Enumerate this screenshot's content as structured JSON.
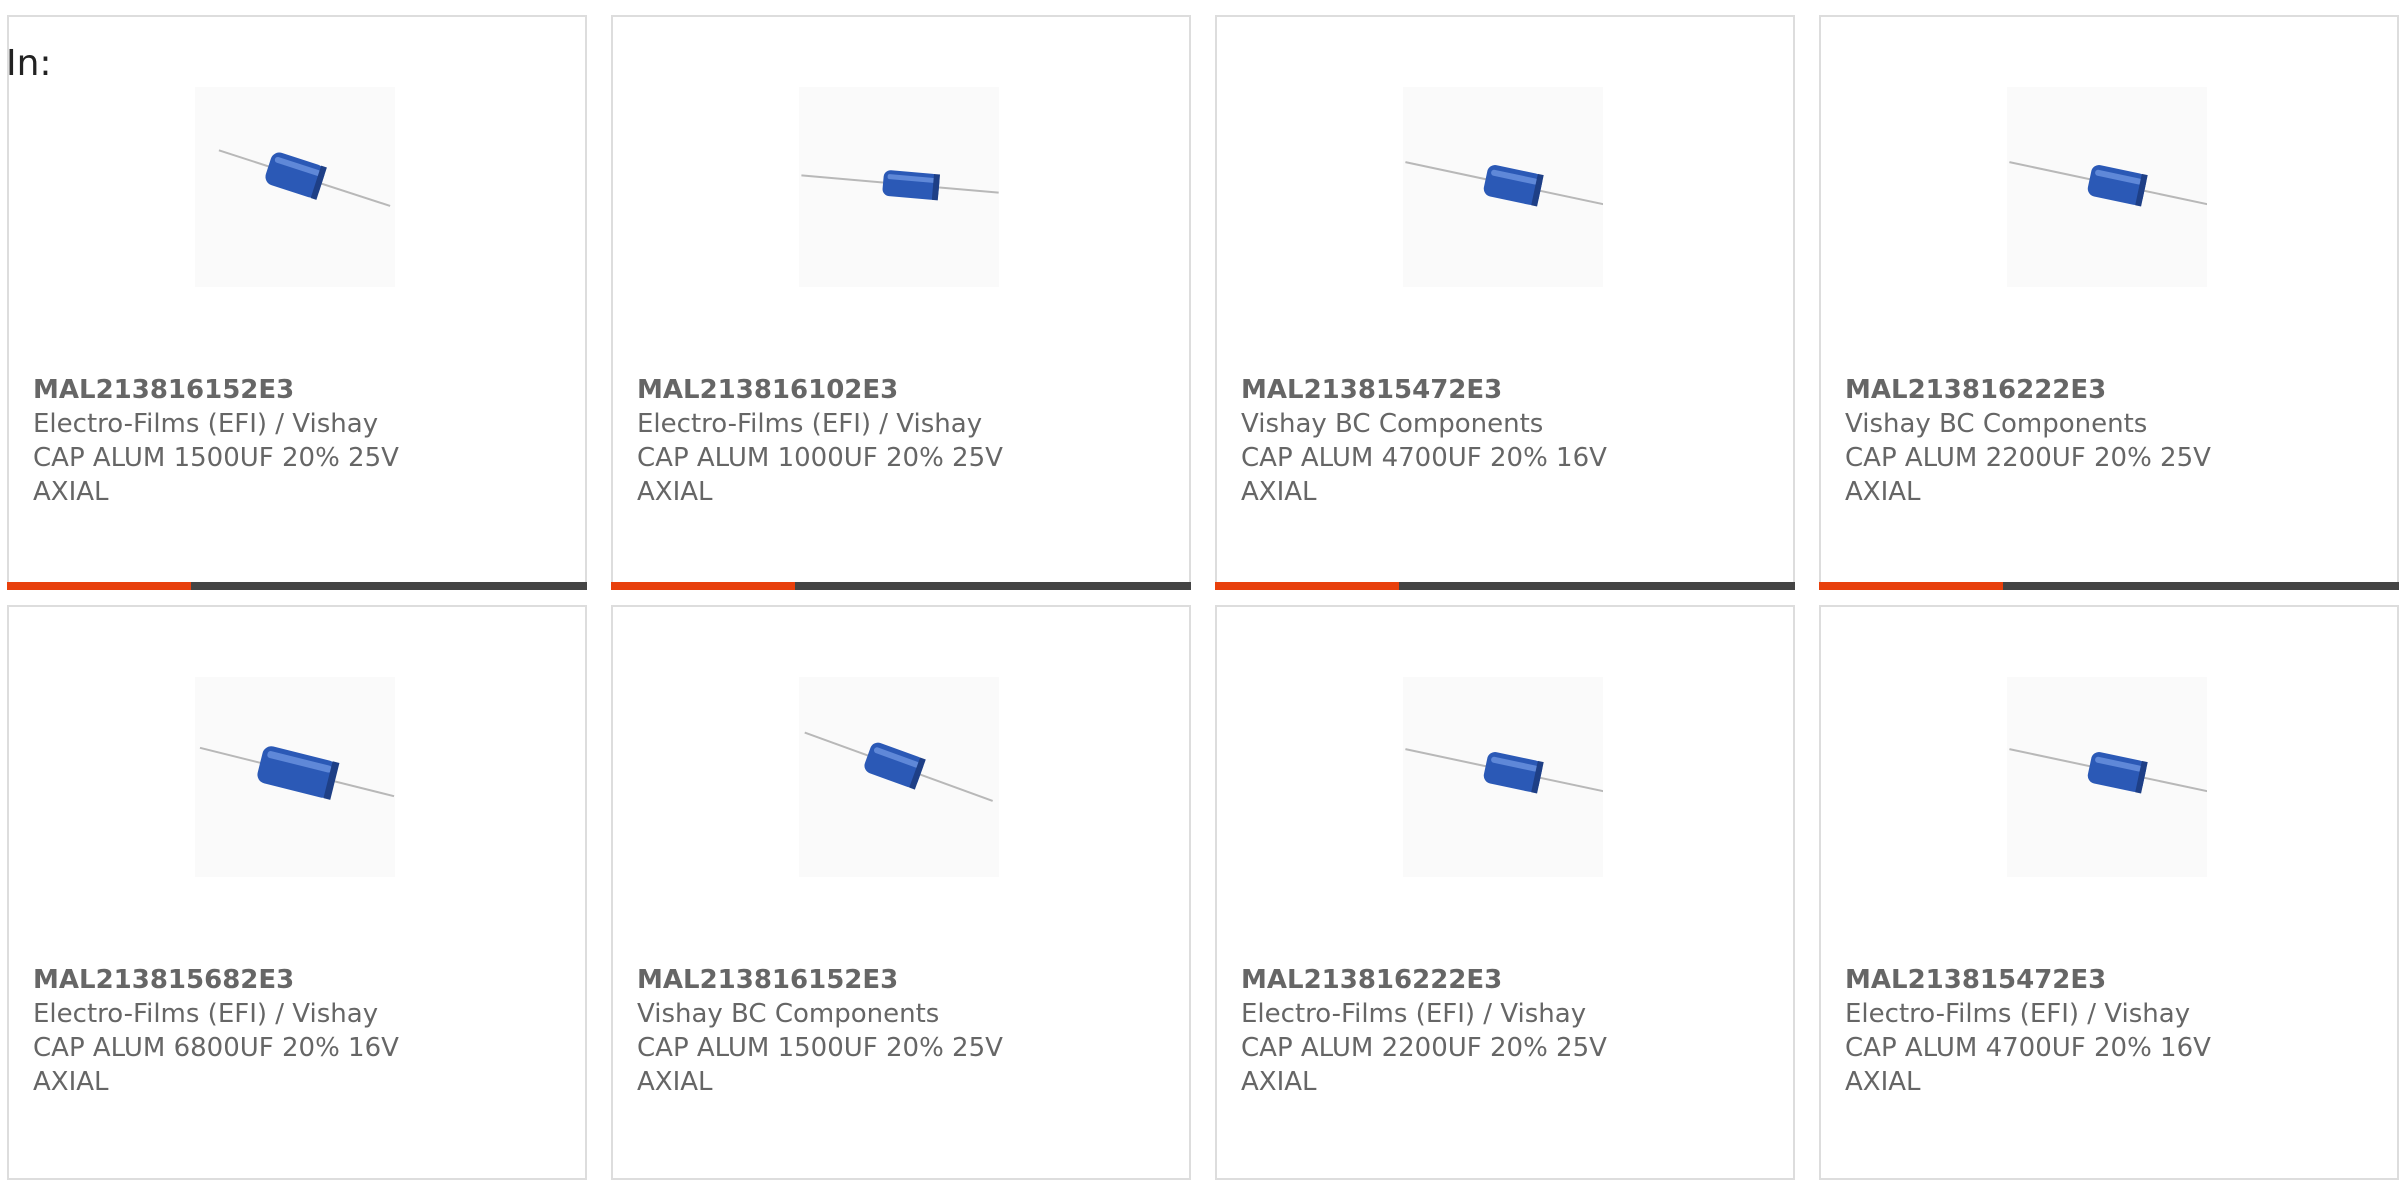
{
  "header": {
    "in_label": "In:"
  },
  "theme": {
    "accent_color": "#e8400c",
    "bar_color": "#444444",
    "text_color": "#666666",
    "capacitor_body_color": "#2b59b6"
  },
  "products": [
    {
      "part_number": "MAL213816152E3",
      "manufacturer": "Electro-Films (EFI) / Vishay",
      "description": "CAP ALUM 1500UF 20% 25V",
      "package": "AXIAL",
      "image_icon": "axial-capacitor-icon"
    },
    {
      "part_number": "MAL213816102E3",
      "manufacturer": "Electro-Films (EFI) / Vishay",
      "description": "CAP ALUM 1000UF 20% 25V",
      "package": "AXIAL",
      "image_icon": "axial-capacitor-icon"
    },
    {
      "part_number": "MAL213815472E3",
      "manufacturer": "Vishay BC Components",
      "description": "CAP ALUM 4700UF 20% 16V",
      "package": "AXIAL",
      "image_icon": "axial-capacitor-icon"
    },
    {
      "part_number": "MAL213816222E3",
      "manufacturer": "Vishay BC Components",
      "description": "CAP ALUM 2200UF 20% 25V",
      "package": "AXIAL",
      "image_icon": "axial-capacitor-icon"
    },
    {
      "part_number": "MAL213815682E3",
      "manufacturer": "Electro-Films (EFI) / Vishay",
      "description": "CAP ALUM 6800UF 20% 16V",
      "package": "AXIAL",
      "image_icon": "axial-capacitor-icon"
    },
    {
      "part_number": "MAL213816152E3",
      "manufacturer": "Vishay BC Components",
      "description": "CAP ALUM 1500UF 20% 25V",
      "package": "AXIAL",
      "image_icon": "axial-capacitor-icon"
    },
    {
      "part_number": "MAL213816222E3",
      "manufacturer": "Electro-Films (EFI) / Vishay",
      "description": "CAP ALUM 2200UF 20% 25V",
      "package": "AXIAL",
      "image_icon": "axial-capacitor-icon"
    },
    {
      "part_number": "MAL213815472E3",
      "manufacturer": "Electro-Films (EFI) / Vishay",
      "description": "CAP ALUM 4700UF 20% 16V",
      "package": "AXIAL",
      "image_icon": "axial-capacitor-icon"
    }
  ]
}
